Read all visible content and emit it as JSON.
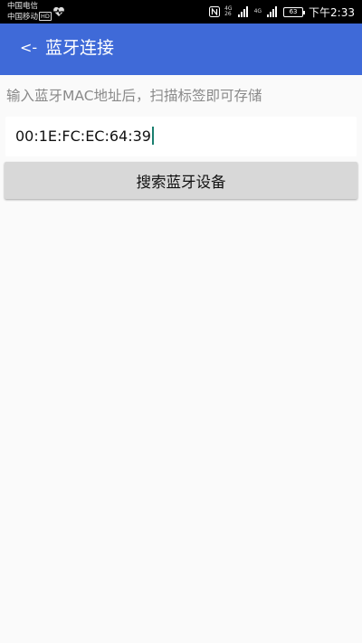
{
  "status_bar": {
    "carrier_1": "中国电信",
    "carrier_2": "中国移动",
    "hd_badge": "HD",
    "network_top": "4G",
    "network_bottom": "26",
    "signal_label": "4G",
    "battery": "63",
    "time": "下午2:33"
  },
  "app_bar": {
    "back_label": "<-",
    "title": "蓝牙连接",
    "background": "#3f6ad8"
  },
  "main": {
    "hint": "输入蓝牙MAC地址后，扫描标签即可存储",
    "mac_value": "00:1E:FC:EC:64:39",
    "search_button_label": "搜索蓝牙设备"
  }
}
